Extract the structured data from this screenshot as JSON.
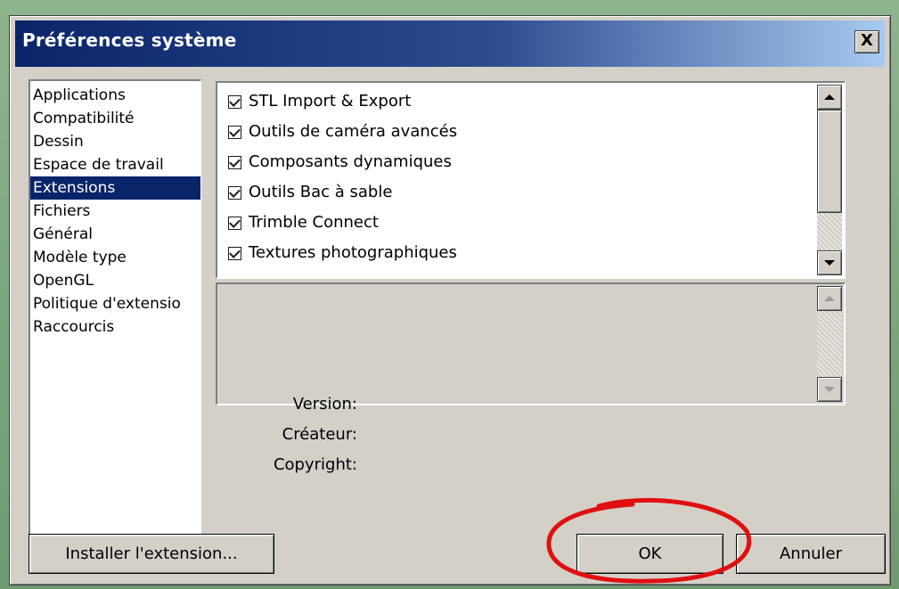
{
  "window": {
    "title": "Préférences système",
    "close_label": "X"
  },
  "sidebar": {
    "items": [
      {
        "label": "Applications",
        "selected": false
      },
      {
        "label": "Compatibilité",
        "selected": false
      },
      {
        "label": "Dessin",
        "selected": false
      },
      {
        "label": "Espace de travail",
        "selected": false
      },
      {
        "label": "Extensions",
        "selected": true
      },
      {
        "label": "Fichiers",
        "selected": false
      },
      {
        "label": "Général",
        "selected": false
      },
      {
        "label": "Modèle type",
        "selected": false
      },
      {
        "label": "OpenGL",
        "selected": false
      },
      {
        "label": "Politique d'extensio",
        "selected": false
      },
      {
        "label": "Raccourcis",
        "selected": false
      }
    ]
  },
  "extensions": {
    "items": [
      {
        "label": "STL Import & Export",
        "checked": true
      },
      {
        "label": "Outils de caméra avancés",
        "checked": true
      },
      {
        "label": "Composants dynamiques",
        "checked": true
      },
      {
        "label": "Outils Bac à sable",
        "checked": true
      },
      {
        "label": "Trimble Connect",
        "checked": true
      },
      {
        "label": "Textures photographiques",
        "checked": true
      }
    ]
  },
  "details": {
    "version_label": "Version:",
    "creator_label": "Créateur:",
    "copyright_label": "Copyright:"
  },
  "buttons": {
    "install_label": "Installer l'extension...",
    "ok_label": "OK",
    "cancel_label": "Annuler"
  },
  "colors": {
    "titlebar_start": "#0a246a",
    "titlebar_end": "#a6caf0",
    "selection": "#0a246a",
    "dialog_face": "#d4d0c8",
    "annotation_circle": "#e01010"
  },
  "icons": {
    "close": "close-icon",
    "scroll_up": "triangle-up-icon",
    "scroll_down": "triangle-down-icon",
    "checkbox": "checkmark-icon"
  }
}
